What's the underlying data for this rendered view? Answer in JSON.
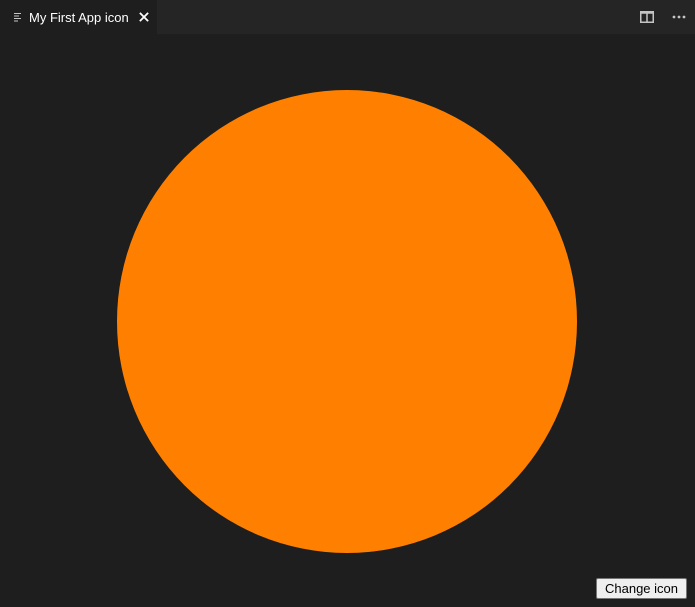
{
  "tab": {
    "title": "My First App icon",
    "file_icon": "lines-icon",
    "close_icon": "close-icon"
  },
  "actions": [
    {
      "icon": "split-editor-icon"
    },
    {
      "icon": "more-icon"
    }
  ],
  "preview": {
    "shape": "circle",
    "fill_color": "#ff8000"
  },
  "change_icon_button": {
    "label": "Change icon"
  }
}
